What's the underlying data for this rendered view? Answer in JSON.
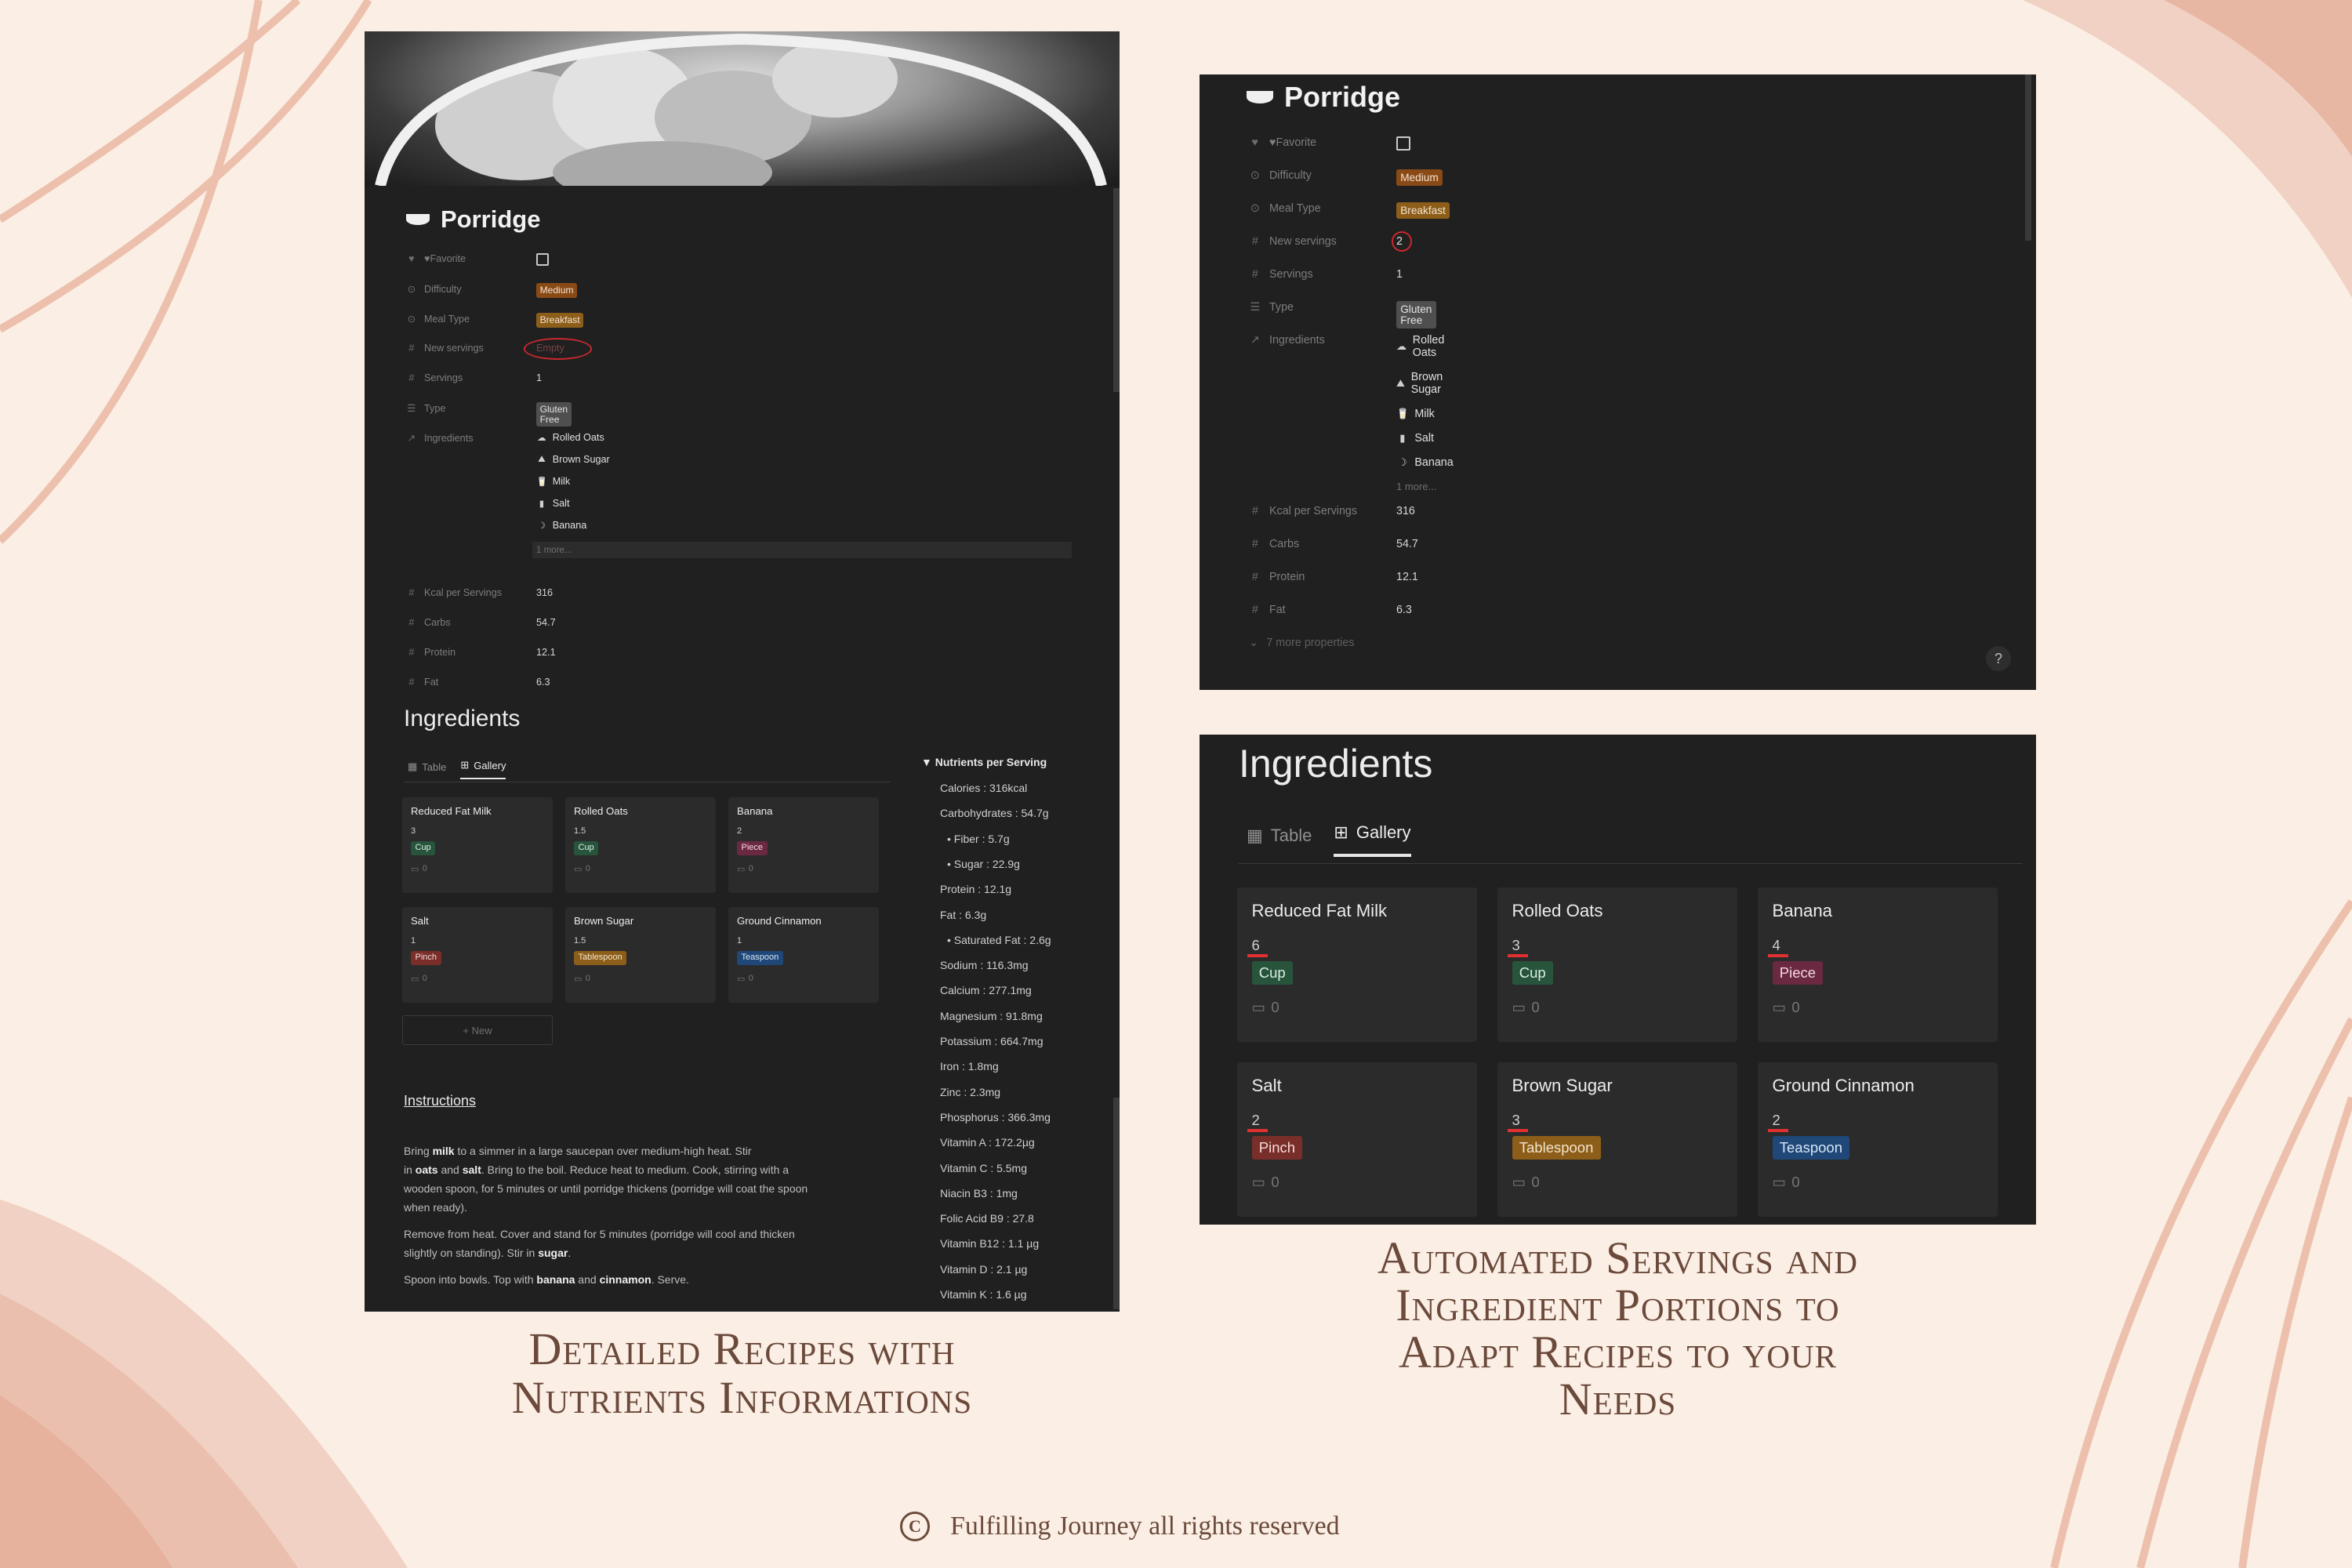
{
  "recipe": {
    "title": "Porridge",
    "properties": {
      "favorite_label": "Favorite",
      "difficulty_label": "Difficulty",
      "difficulty_value": "Medium",
      "meal_type_label": "Meal Type",
      "meal_type_value": "Breakfast",
      "new_servings_label": "New servings",
      "new_servings_empty": "Empty",
      "new_servings_value": "2",
      "servings_label": "Servings",
      "servings_value": "1",
      "type_label": "Type",
      "type_value": "Gluten Free",
      "ingredients_label": "Ingredients",
      "ingredients_list": [
        "Rolled Oats",
        "Brown Sugar",
        "Milk",
        "Salt",
        "Banana"
      ],
      "more_label": "1 more...",
      "kcal_label": "Kcal per Servings",
      "kcal_value": "316",
      "carbs_label": "Carbs",
      "carbs_value": "54.7",
      "protein_label": "Protein",
      "protein_value": "12.1",
      "fat_label": "Fat",
      "fat_value": "6.3",
      "more_properties": "7 more properties"
    }
  },
  "ingredients_section": {
    "heading": "Ingredients",
    "tab_table": "Table",
    "tab_gallery": "Gallery",
    "new_button": "+ New",
    "cards_left": [
      {
        "name": "Reduced Fat Milk",
        "qty": "3",
        "unit": "Cup",
        "comments": "0"
      },
      {
        "name": "Rolled Oats",
        "qty": "1.5",
        "unit": "Cup",
        "comments": "0"
      },
      {
        "name": "Banana",
        "qty": "2",
        "unit": "Piece",
        "comments": "0"
      },
      {
        "name": "Salt",
        "qty": "1",
        "unit": "Pinch",
        "comments": "0"
      },
      {
        "name": "Brown Sugar",
        "qty": "1.5",
        "unit": "Tablespoon",
        "comments": "0"
      },
      {
        "name": "Ground Cinnamon",
        "qty": "1",
        "unit": "Teaspoon",
        "comments": "0"
      }
    ],
    "cards_right": [
      {
        "name": "Reduced Fat Milk",
        "qty": "6",
        "unit": "Cup",
        "comments": "0"
      },
      {
        "name": "Rolled Oats",
        "qty": "3",
        "unit": "Cup",
        "comments": "0"
      },
      {
        "name": "Banana",
        "qty": "4",
        "unit": "Piece",
        "comments": "0"
      },
      {
        "name": "Salt",
        "qty": "2",
        "unit": "Pinch",
        "comments": "0"
      },
      {
        "name": "Brown Sugar",
        "qty": "3",
        "unit": "Tablespoon",
        "comments": "0"
      },
      {
        "name": "Ground Cinnamon",
        "qty": "2",
        "unit": "Teaspoon",
        "comments": "0"
      }
    ]
  },
  "nutrients": {
    "title": "Nutrients per Serving",
    "items": [
      "Calories : 316kcal",
      "Carbohydrates : 54.7g",
      "Fiber : 5.7g",
      "Sugar : 22.9g",
      "Protein : 12.1g",
      "Fat : 6.3g",
      "Saturated Fat : 2.6g",
      "Sodium : 116.3mg",
      "Calcium : 277.1mg",
      "Magnesium : 91.8mg",
      "Potassium : 664.7mg",
      "Iron : 1.8mg",
      "Zinc : 2.3mg",
      "Phosphorus : 366.3mg",
      "Vitamin A : 172.2µg",
      "Vitamin C : 5.5mg",
      "Niacin B3 : 1mg",
      "Folic Acid B9 : 27.8",
      "Vitamin B12 : 1.1 µg",
      "Vitamin D : 2.1 µg",
      "Vitamin K : 1.6 µg"
    ]
  },
  "instructions": {
    "heading": "Instructions",
    "p1_a": "Bring ",
    "p1_b": "milk",
    "p1_c": " to a simmer in a large saucepan over medium-high heat. Stir",
    "p2_a": "in ",
    "p2_b": "oats",
    "p2_c": " and ",
    "p2_d": "salt",
    "p2_e": ". Bring to the boil. Reduce heat to medium. Cook, stirring with a",
    "p3": "wooden spoon, for 5 minutes or until porridge thickens (porridge will coat the spoon",
    "p4": "when ready).",
    "p5": "Remove from heat. Cover and stand for 5 minutes (porridge will cool and thicken",
    "p6_a": "slightly on standing). Stir in ",
    "p6_b": "sugar",
    "p6_c": ".",
    "p7_a": "Spoon into bowls. Top with ",
    "p7_b": "banana",
    "p7_c": " and ",
    "p7_d": "cinnamon",
    "p7_e": ". Serve."
  },
  "captions": {
    "left_line1": "Detailed Recipes with",
    "left_line2": "Nutrients Informations",
    "right_line1": "Automated Servings and",
    "right_line2": "Ingredient Portions to",
    "right_line3": "Adapt Recipes to your",
    "right_line4": "Needs",
    "footer": "Fulfilling Journey all rights reserved",
    "copyright_symbol": "C"
  },
  "colors": {
    "background": "#fbeee4",
    "panel": "#202020",
    "card": "#2b2b2b",
    "caption": "#6b4a3b",
    "highlight_red": "#c8282d"
  }
}
